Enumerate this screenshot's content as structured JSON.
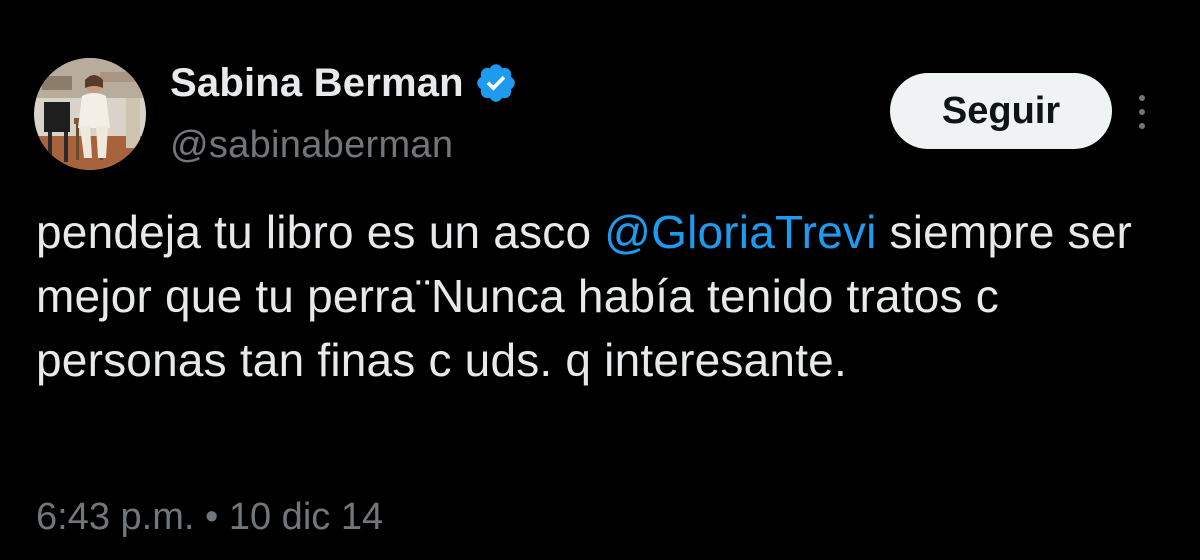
{
  "user": {
    "display_name": "Sabina Berman",
    "handle": "@sabinaberman",
    "verified_color": "#1d9bf0",
    "avatar_icon": "profile-photo"
  },
  "actions": {
    "follow_label": "Seguir",
    "more_icon": "vertical-ellipsis-icon"
  },
  "tweet": {
    "text_before": "pendeja tu libro es un asco ",
    "mention": "@GloriaTrevi",
    "text_after": " siempre ser mejor que tu perra¨Nunca había tenido tratos c personas tan finas c uds. q interesante."
  },
  "meta": {
    "time": "6:43 p.m.",
    "separator": "•",
    "date": "10 dic 14"
  },
  "colors": {
    "background": "#000000",
    "text": "#e7e9ea",
    "secondary": "#71767b",
    "link": "#1d9bf0",
    "button_bg": "#eff3f4"
  }
}
